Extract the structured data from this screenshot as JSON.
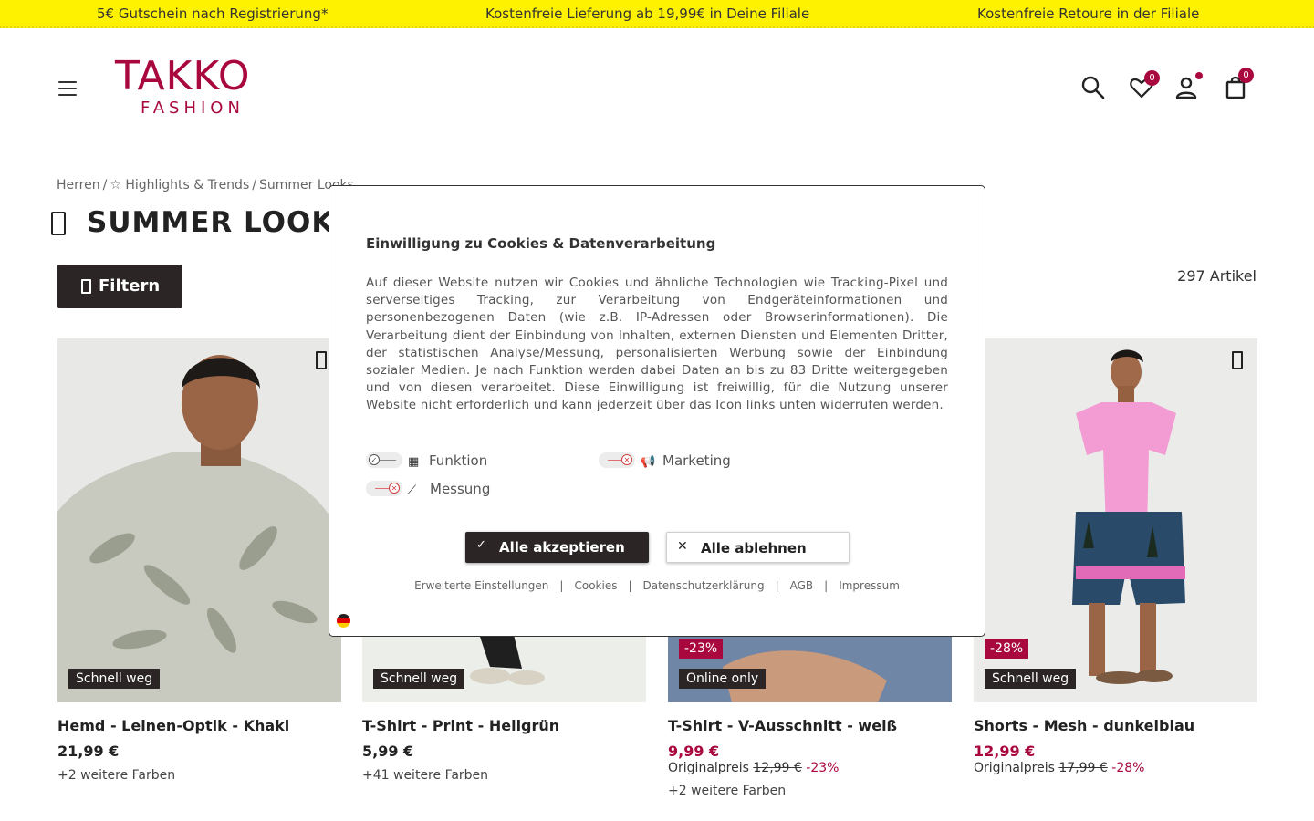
{
  "promo": {
    "items": [
      "5€ Gutschein nach Registrierung*",
      "Kostenfreie Lieferung ab 19,99€ in Deine Filiale",
      "Kostenfreie Retoure in der Filiale"
    ],
    "color": "#fff200"
  },
  "header": {
    "logo_top": "TAKKO",
    "logo_bottom": "FASHION",
    "brand_color": "#a9083f",
    "wishlist_count": "0",
    "cart_count": "0"
  },
  "breadcrumb": [
    "Herren",
    "☆ Highlights & Trends",
    "Summer Looks"
  ],
  "page": {
    "title": "SUMMER LOOKS",
    "filter_label": "Filtern",
    "article_count": "297 Artikel"
  },
  "products": [
    {
      "name": "Hemd - Leinen-Optik - Khaki",
      "price": "21,99 €",
      "badge": "Schnell weg",
      "colors": "+2 weitere Farben"
    },
    {
      "name": "T-Shirt - Print - Hellgrün",
      "price": "5,99 €",
      "badge": "Schnell weg",
      "colors": "+41 weitere Farben"
    },
    {
      "name": "T-Shirt - V-Ausschnitt - weiß",
      "price": "9,99 €",
      "badge": "Online only",
      "discount": "-23%",
      "orig_label": "Originalpreis",
      "orig_price": "12,99 €",
      "orig_pct": "-23%",
      "colors": "+2 weitere Farben"
    },
    {
      "name": "Shorts - Mesh - dunkelblau",
      "price": "12,99 €",
      "badge": "Schnell weg",
      "discount": "-28%",
      "orig_label": "Originalpreis",
      "orig_price": "17,99 €",
      "orig_pct": "-28%"
    }
  ],
  "cookie": {
    "title": "Einwilligung zu Cookies & Datenverarbeitung",
    "body": "Auf dieser Website nutzen wir Cookies und ähnliche Technologien wie Tracking-Pixel und serverseitiges Tracking, zur Verarbeitung von Endgeräteinformationen und personenbezogenen Daten (wie z.B. IP-Adressen oder Browserinformationen). Die Verarbeitung dient der Einbindung von Inhalten, externen Diensten und Elementen Dritter, der statistischen Analyse/Messung, personalisierten Werbung sowie der Einbindung sozialer Medien. Je nach Funktion werden dabei Daten an bis zu 83 Dritte weitergegeben und von diesen verarbeitet. Diese Einwilligung ist freiwillig, für die Nutzung unserer Website nicht erforderlich und kann jederzeit über das Icon links unten widerrufen werden.",
    "toggles": [
      {
        "label": "Funktion",
        "state": "on"
      },
      {
        "label": "Marketing",
        "state": "off"
      },
      {
        "label": "Messung",
        "state": "off"
      }
    ],
    "accept_label": "Alle akzeptieren",
    "reject_label": "Alle ablehnen",
    "links": [
      "Erweiterte Einstellungen",
      "Cookies",
      "Datenschutzerklärung",
      "AGB",
      "Impressum"
    ]
  }
}
